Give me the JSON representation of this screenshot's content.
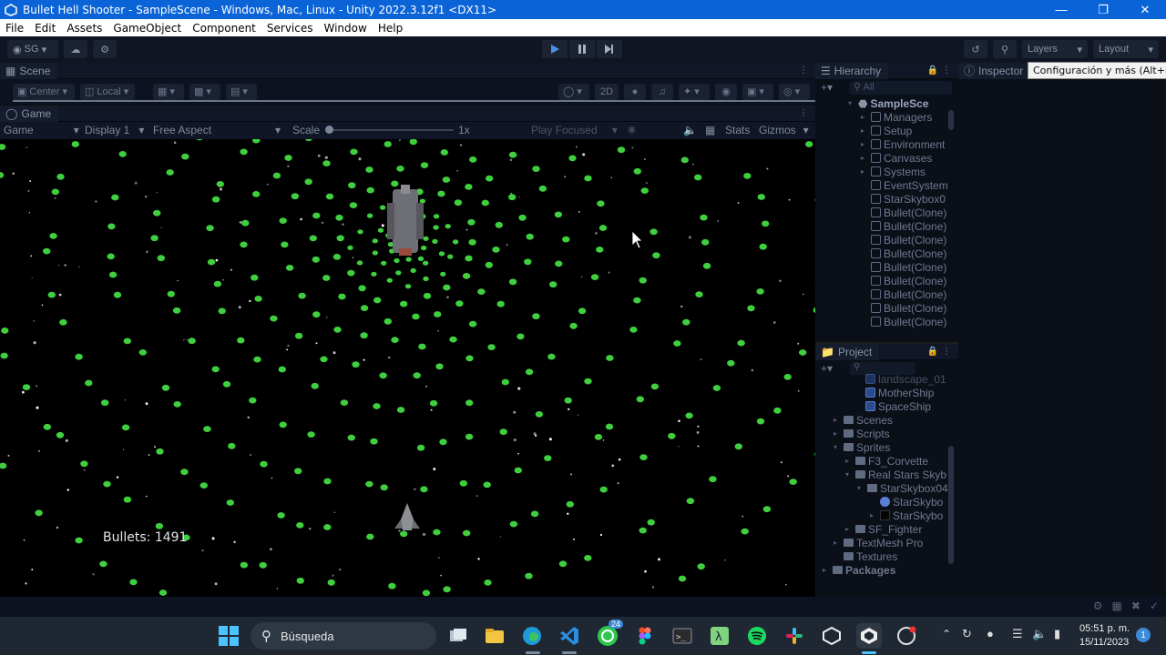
{
  "window": {
    "title": "Bullet Hell Shooter - SampleScene - Windows, Mac, Linux - Unity 2022.3.12f1 <DX11>",
    "controls": [
      "minimize-icon",
      "restore-icon",
      "close-icon"
    ]
  },
  "menu": [
    "File",
    "Edit",
    "Assets",
    "GameObject",
    "Component",
    "Services",
    "Window",
    "Help"
  ],
  "toolbar": {
    "account": "SG",
    "layers": "Layers",
    "layout": "Layout"
  },
  "scene": {
    "tab": "Scene",
    "pivot": "Center",
    "space": "Local",
    "mode_2d": "2D"
  },
  "game": {
    "tab": "Game",
    "view": "Game",
    "display": "Display 1",
    "aspect": "Free Aspect",
    "scale_label": "Scale",
    "scale_value": "1x",
    "play_focused": "Play Focused",
    "stats": "Stats",
    "gizmos": "Gizmos",
    "bullets_label": "Bullets: 1491"
  },
  "hierarchy": {
    "tab": "Hierarchy",
    "search_placeholder": "All",
    "items": [
      {
        "label": "SampleSce",
        "type": "scene"
      },
      {
        "label": "Managers",
        "type": "prefab",
        "expandable": true
      },
      {
        "label": "Setup",
        "type": "prefab",
        "expandable": true
      },
      {
        "label": "Environment",
        "type": "prefab",
        "expandable": true
      },
      {
        "label": "Canvases",
        "type": "prefab",
        "expandable": true
      },
      {
        "label": "Systems",
        "type": "prefab",
        "expandable": true
      },
      {
        "label": "EventSystem",
        "type": "object"
      },
      {
        "label": "StarSkybox0",
        "type": "object"
      },
      {
        "label": "Bullet(Clone)",
        "type": "object"
      },
      {
        "label": "Bullet(Clone)",
        "type": "object"
      },
      {
        "label": "Bullet(Clone)",
        "type": "object"
      },
      {
        "label": "Bullet(Clone)",
        "type": "object"
      },
      {
        "label": "Bullet(Clone)",
        "type": "object"
      },
      {
        "label": "Bullet(Clone)",
        "type": "object"
      },
      {
        "label": "Bullet(Clone)",
        "type": "object"
      },
      {
        "label": "Bullet(Clone)",
        "type": "object"
      },
      {
        "label": "Bullet(Clone)",
        "type": "object"
      }
    ]
  },
  "project": {
    "tab": "Project",
    "items": [
      {
        "label": "landscape_01",
        "type": "prefab"
      },
      {
        "label": "MotherShip",
        "type": "prefab"
      },
      {
        "label": "SpaceShip",
        "type": "prefab"
      },
      {
        "label": "Scenes",
        "type": "folder"
      },
      {
        "label": "Scripts",
        "type": "folder"
      },
      {
        "label": "Sprites",
        "type": "folder"
      },
      {
        "label": "F3_Corvette",
        "type": "folder"
      },
      {
        "label": "Real Stars Skyb",
        "type": "folder"
      },
      {
        "label": "StarSkybox04",
        "type": "folder"
      },
      {
        "label": "StarSkybo",
        "type": "material"
      },
      {
        "label": "StarSkybo",
        "type": "texture"
      },
      {
        "label": "SF_Fighter",
        "type": "folder"
      },
      {
        "label": "TextMesh Pro",
        "type": "folder"
      },
      {
        "label": "Textures",
        "type": "folder"
      },
      {
        "label": "Packages",
        "type": "folder"
      }
    ]
  },
  "inspector": {
    "tab": "Inspector",
    "tooltip": "Configuración y más (Alt+F)"
  },
  "taskbar": {
    "search": "Búsqueda",
    "whatsapp_badge": "24",
    "time": "05:51 p. m.",
    "date": "15/11/2023",
    "notifications": "1",
    "apps": [
      "task-view-icon",
      "file-explorer-icon",
      "edge-icon",
      "vscode-icon",
      "whatsapp-icon",
      "figma-icon",
      "terminal-icon",
      "lambda-icon",
      "spotify-icon",
      "slack-icon",
      "unity-hub-icon",
      "unity-icon",
      "app-icon"
    ]
  },
  "colors": {
    "titlebar": "#0a64d8",
    "editor_bg": "#0b0f18",
    "bullet": "#3fcf3f",
    "taskbar": "#1f2733"
  }
}
